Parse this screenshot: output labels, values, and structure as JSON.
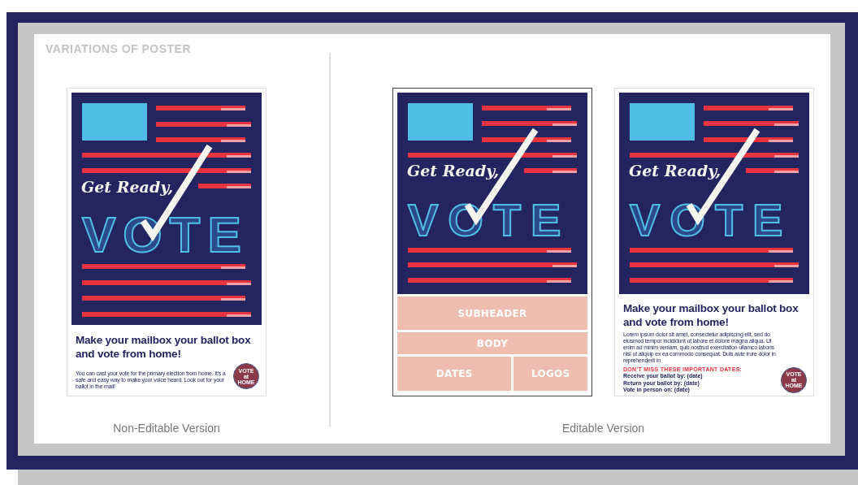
{
  "section_title": "VARIATIONS OF POSTER",
  "groups": [
    {
      "caption": "Non-Editable Version",
      "posters": [
        {
          "kind": "full",
          "art": {
            "script": "Get Ready,",
            "word": "VOTE"
          },
          "heading": "Make your mailbox your ballot box and vote from home!",
          "body": "You can cast your vote for the primary election from home. It's a safe and easy way to make your voice heard. Look out for your ballot in the mail!",
          "badge": [
            "VOTE",
            "at",
            "HOME"
          ]
        }
      ]
    },
    {
      "caption": "Editable Version",
      "posters": [
        {
          "kind": "template",
          "art": {
            "script": "Get Ready,",
            "word": "VOTE"
          },
          "block_rows": [
            [
              "SUBHEADER"
            ],
            [
              "BODY"
            ],
            [
              "DATES",
              "LOGOS"
            ]
          ]
        },
        {
          "kind": "sample",
          "art": {
            "script": "Get Ready,",
            "word": "VOTE"
          },
          "heading": "Make your mailbox your ballot box and vote from home!",
          "body": "Lorem ipsum dolor sit amet, consectetur adipiscing elit, sed do eiusmod tempor incididunt ut labore et dolore magna aliqua. Ut enim ad minim veniam, quis nostrud exercitation ullamco laboris nisi ut aliquip ex ea commodo consequat. Duis aute irure dolor in reprehenderit in",
          "dates_title": "DON'T MISS THESE IMPORTANT DATES:",
          "dates": [
            "Receive your ballot by: (date)",
            "Return your ballot by: (date)",
            "Vote in person on: (date)"
          ],
          "badge": [
            "VOTE",
            "at",
            "HOME"
          ]
        }
      ]
    }
  ]
}
